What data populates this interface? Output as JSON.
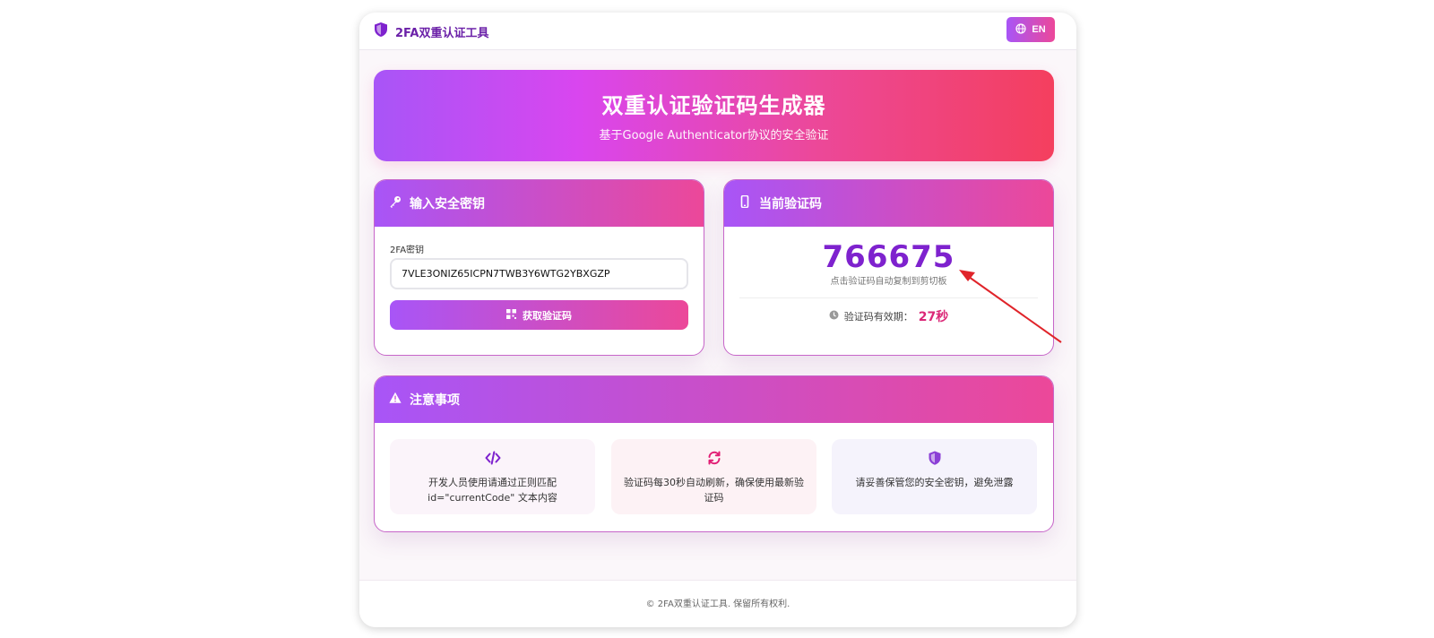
{
  "header": {
    "brand": "2FA双重认证工具",
    "lang_button": "EN"
  },
  "hero": {
    "title": "双重认证验证码生成器",
    "subtitle": "基于Google Authenticator协议的安全验证"
  },
  "secret_card": {
    "title": "输入安全密钥",
    "field_label": "2FA密钥",
    "secret_value": "7VLE3ONIZ65ICPN7TWB3Y6WTG2YBXGZP",
    "button_label": "获取验证码"
  },
  "code_card": {
    "title": "当前验证码",
    "code": "766675",
    "hint": "点击验证码自动复制到剪切板",
    "validity_label": "验证码有效期：",
    "seconds_left": "27秒"
  },
  "notes_card": {
    "title": "注意事项",
    "items": [
      {
        "icon": "code-icon",
        "text_line1": "开发人员使用请通过正则匹配",
        "text_line2": "id=\"currentCode\" 文本内容"
      },
      {
        "icon": "refresh-icon",
        "text_line1": "验证码每30秒自动刷新，确保使用最新验",
        "text_line2": "证码"
      },
      {
        "icon": "shield-icon",
        "text_line1": "请妥善保管您的安全密钥，避免泄露",
        "text_line2": ""
      }
    ]
  },
  "footer": {
    "text": "© 2FA双重认证工具. 保留所有权利."
  },
  "colors": {
    "brand_purple": "#7e22ce",
    "gradient_start": "#a855f7",
    "gradient_mid": "#ec4899",
    "gradient_end": "#f43f5e",
    "annotation_arrow": "#e0242a"
  }
}
